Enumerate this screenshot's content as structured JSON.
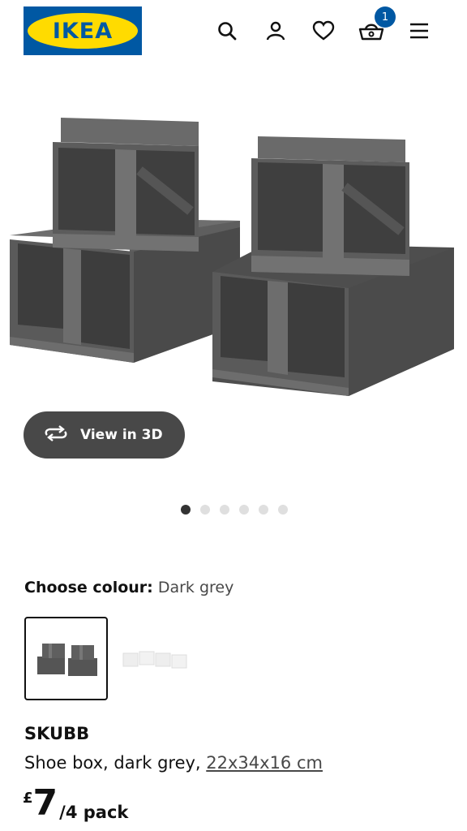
{
  "header": {
    "logo_text": "IKEA",
    "icons": [
      "search-icon",
      "profile-icon",
      "heart-icon",
      "basket-icon",
      "menu-icon"
    ],
    "basket_count": "1",
    "brand_blue": "#0058a3",
    "brand_yellow": "#ffdb00"
  },
  "gallery": {
    "view3d_label": "View in 3D",
    "slide_count": 6,
    "active_slide": 1
  },
  "colour": {
    "label": "Choose colour:",
    "value": "Dark grey",
    "swatches": [
      "dark grey",
      "white"
    ]
  },
  "product": {
    "name": "SKUBB",
    "description": "Shoe box, dark grey, ",
    "measurement": "22x34x16 cm",
    "currency": "£",
    "price": "7",
    "unit": "/4 pack"
  }
}
